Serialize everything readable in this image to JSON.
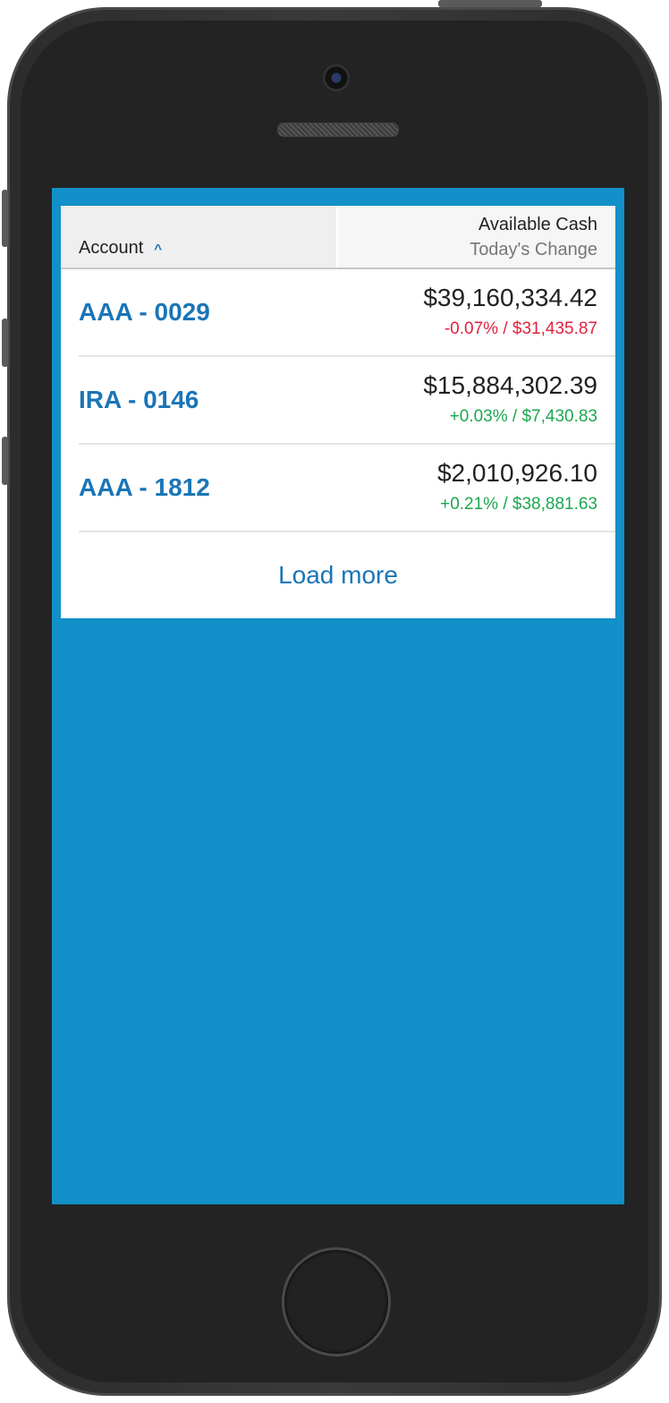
{
  "table": {
    "header": {
      "account_label": "Account",
      "sort_indicator": "^",
      "cash_label": "Available Cash",
      "change_label": "Today's Change"
    },
    "rows": [
      {
        "account": "AAA - 0029",
        "cash": "$39,160,334.42",
        "change": "-0.07% / $31,435.87",
        "direction": "down"
      },
      {
        "account": "IRA - 0146",
        "cash": "$15,884,302.39",
        "change": "+0.03% / $7,430.83",
        "direction": "up"
      },
      {
        "account": "AAA - 1812",
        "cash": "$2,010,926.10",
        "change": "+0.21% / $38,881.63",
        "direction": "up"
      }
    ],
    "load_more_label": "Load more"
  },
  "colors": {
    "screen_bg": "#1290c9",
    "link_blue": "#1a75b6",
    "negative": "#e3213c",
    "positive": "#1aa74f"
  },
  "icons": {
    "sort": "chevron-up-icon"
  }
}
